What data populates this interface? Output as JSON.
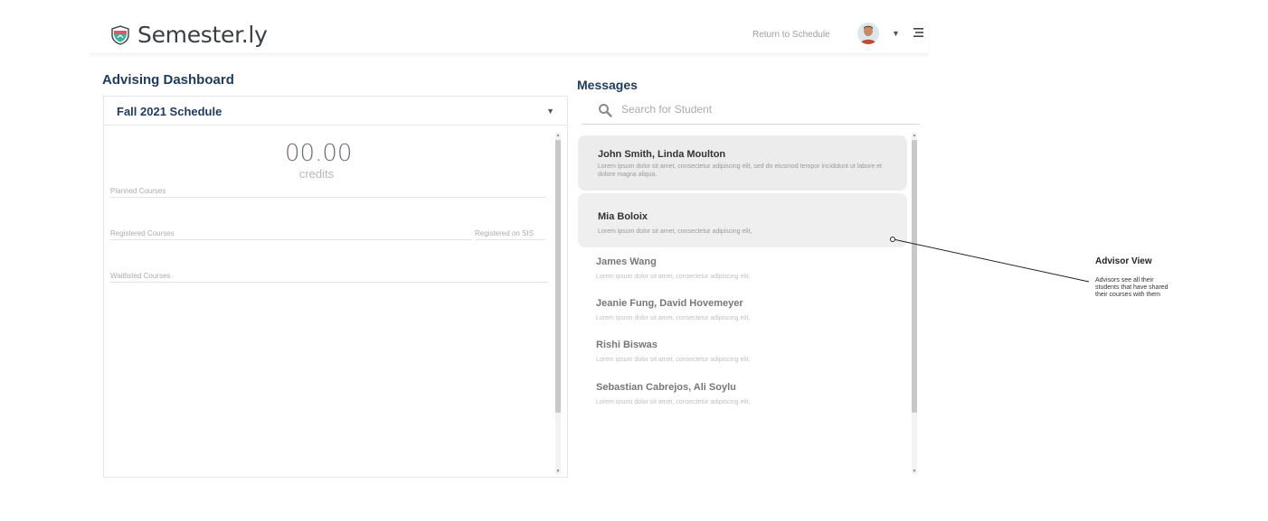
{
  "header": {
    "brand": "Semester.ly",
    "return_link": "Return to Schedule",
    "icons": [
      "shield-logo-icon",
      "avatar",
      "chevron-down-icon",
      "menu-icon"
    ]
  },
  "dashboard": {
    "title": "Advising Dashboard",
    "schedule_select": "Fall 2021 Schedule",
    "credits_value": "00.00",
    "credits_label": "credits",
    "planned_label": "Planned Courses",
    "registered_label": "Registered Courses",
    "registered_sis_label": "Registered on SIS",
    "waitlisted_label": "Waitlisted Courses"
  },
  "messages": {
    "title": "Messages",
    "search_placeholder": "Search for Student",
    "items": [
      {
        "name": "John Smith, Linda Moulton",
        "preview": "Lorem ipsum dolor sit amet, consectetur adipiscing elit, sed do eiusmod tempor incididunt ut labore et dolore magna aliqua."
      },
      {
        "name": "Mia Boloix",
        "preview": "Lorem ipsum dolor sit amet, consectetur adipiscing elit,"
      },
      {
        "name": "James Wang",
        "preview": "Lorem ipsum dolor sit amet, consectetur adipiscing elit,"
      },
      {
        "name": "Jeanie Fung, David Hovemeyer",
        "preview": "Lorem ipsum dolor sit amet, consectetur adipiscing elit,"
      },
      {
        "name": "Rishi Biswas",
        "preview": "Lorem ipsum dolor sit amet, consectetur adipiscing elit,"
      },
      {
        "name": "Sebastian Cabrejos, Ali Soylu",
        "preview": "Lorem ipsum dolor sit amet, consectetur adipiscing elit,"
      }
    ]
  },
  "annotation": {
    "title": "Advisor View",
    "text": "Advisors see all their students that have shared their courses with them"
  },
  "colors": {
    "heading": "#1f3b5b",
    "card_bg": "#ececec",
    "logo_teal": "#3bb3a4",
    "logo_red": "#e25563"
  }
}
